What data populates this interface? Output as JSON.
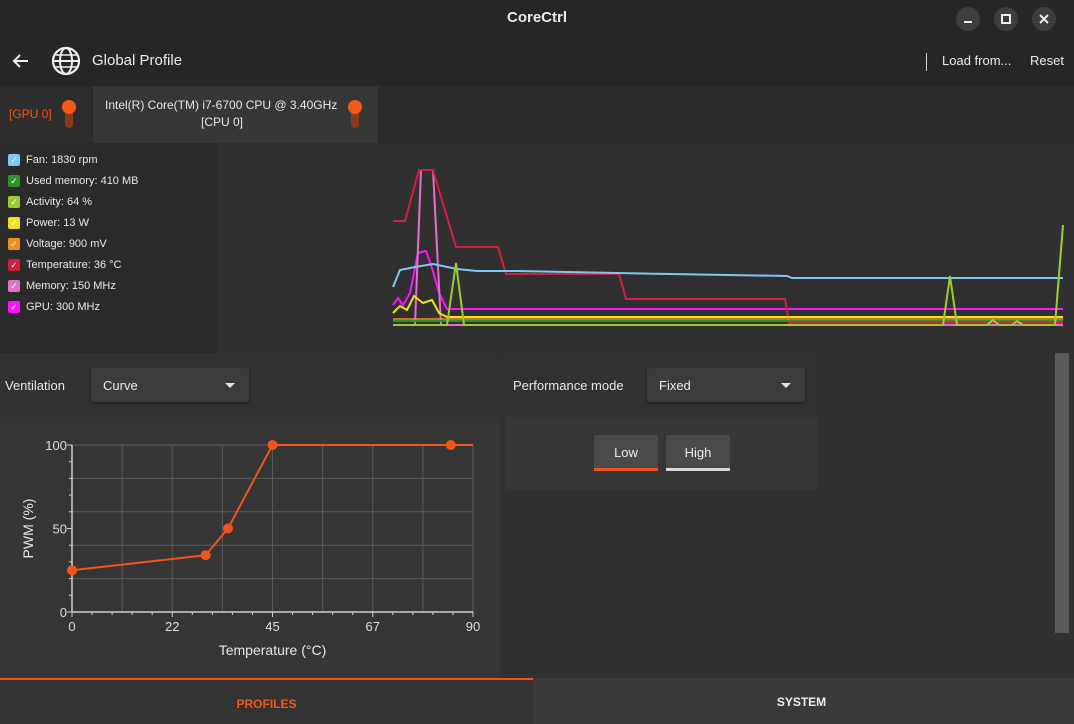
{
  "window": {
    "title": "CoreCtrl",
    "minimize_icon": "minimize-icon",
    "maximize_icon": "maximize-icon",
    "close_icon": "close-icon"
  },
  "header": {
    "back_icon": "arrow-left-icon",
    "profile_icon": "globe-icon",
    "title": "Global Profile",
    "load_label": "Load from...",
    "reset_label": "Reset"
  },
  "devices": [
    {
      "label": "[GPU 0]",
      "enabled": true
    },
    {
      "label": "Intel(R) Core(TM) i7-6700 CPU @ 3.40GHz",
      "sublabel": "[CPU 0]",
      "enabled": true
    }
  ],
  "sensors": [
    {
      "label": "Fan: 1830 rpm",
      "color": "#7cc8f2",
      "checked": true
    },
    {
      "label": "Used memory: 410 MB",
      "color": "#2f8f2f",
      "checked": true
    },
    {
      "label": "Activity: 64 %",
      "color": "#9acd32",
      "checked": true
    },
    {
      "label": "Power: 13 W",
      "color": "#f0e020",
      "checked": true
    },
    {
      "label": "Voltage: 900 mV",
      "color": "#f0901a",
      "checked": true
    },
    {
      "label": "Temperature: 36 °C",
      "color": "#d21e3c",
      "checked": true
    },
    {
      "label": "Memory: 150 MHz",
      "color": "#e070c8",
      "checked": true
    },
    {
      "label": "GPU: 300 MHz",
      "color": "#ff10ff",
      "checked": true
    }
  ],
  "ventilation": {
    "label": "Ventilation",
    "mode": "Curve",
    "chart_data": {
      "type": "line",
      "xlabel": "Temperature (°C)",
      "ylabel": "PWM (%)",
      "xlim": [
        0,
        90
      ],
      "ylim": [
        0,
        100
      ],
      "x_ticks": [
        "0",
        "22",
        "45",
        "67",
        "90"
      ],
      "y_ticks": [
        "0",
        "50",
        "100"
      ],
      "grid": true,
      "color": "#f0541a",
      "points": [
        [
          0,
          25
        ],
        [
          30,
          34
        ],
        [
          35,
          50
        ],
        [
          45,
          100
        ],
        [
          85,
          100
        ]
      ]
    }
  },
  "performance": {
    "label": "Performance mode",
    "mode": "Fixed",
    "buttons": [
      {
        "label": "Low",
        "active": true
      },
      {
        "label": "High",
        "active": false
      }
    ]
  },
  "bottom_tabs": [
    {
      "label": "PROFILES",
      "active": true
    },
    {
      "label": "SYSTEM",
      "active": false
    }
  ],
  "colors": {
    "accent": "#f0541a",
    "background": "#303030"
  }
}
